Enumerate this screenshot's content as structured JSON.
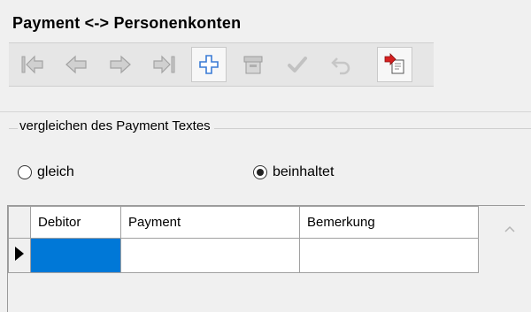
{
  "window": {
    "title": "Payment <-> Personenkonten"
  },
  "toolbar": {
    "buttons": [
      {
        "name": "first-record",
        "icon": "first-icon",
        "enabled": false
      },
      {
        "name": "prev-record",
        "icon": "prev-icon",
        "enabled": false
      },
      {
        "name": "next-record",
        "icon": "next-icon",
        "enabled": false
      },
      {
        "name": "last-record",
        "icon": "last-icon",
        "enabled": false
      },
      {
        "name": "add-record",
        "icon": "plus-icon",
        "enabled": true
      },
      {
        "name": "delete-record",
        "icon": "delete-icon",
        "enabled": false
      },
      {
        "name": "save-record",
        "icon": "check-icon",
        "enabled": false
      },
      {
        "name": "undo-record",
        "icon": "undo-icon",
        "enabled": false
      },
      {
        "name": "import-record",
        "icon": "import-icon",
        "enabled": true
      }
    ]
  },
  "compare": {
    "legend": "vergleichen des Payment Textes",
    "options": [
      {
        "label": "gleich",
        "selected": false
      },
      {
        "label": "beinhaltet",
        "selected": true
      }
    ]
  },
  "grid": {
    "columns": [
      "Debitor",
      "Payment",
      "Bemerkung"
    ],
    "rows": [
      {
        "Debitor": "",
        "Payment": "",
        "Bemerkung": ""
      }
    ]
  },
  "colors": {
    "selection": "#0078d7",
    "accent_blue": "#3a7bd5",
    "import_red": "#d62020",
    "disabled_gray": "#b8b8b8"
  }
}
